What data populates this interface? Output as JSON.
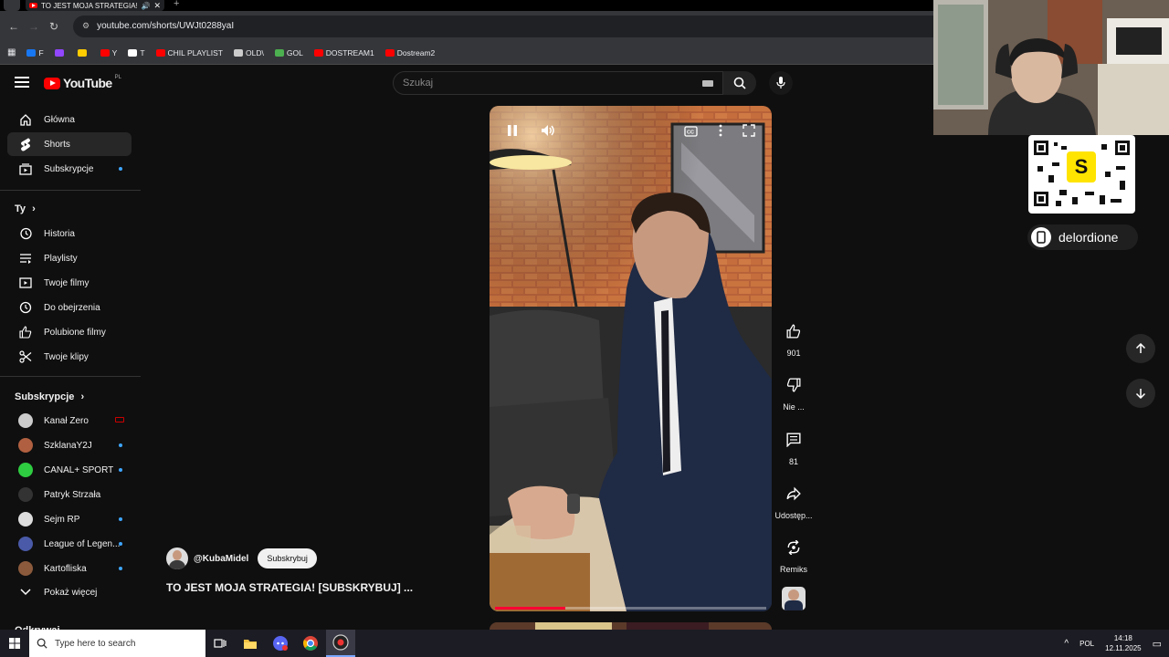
{
  "browser": {
    "tab_title": "TO JEST MOJA STRATEGIA!",
    "url": "youtube.com/shorts/UWJt0288yaI",
    "bookmarks": [
      {
        "label": "F",
        "color": "#1877f2"
      },
      {
        "label": "",
        "color": "#9146ff"
      },
      {
        "label": "",
        "color": "#ffcc00"
      },
      {
        "label": "Y",
        "color": "#ff0000"
      },
      {
        "label": "T",
        "color": "#ffffff"
      },
      {
        "label": "CHIL PLAYLIST",
        "color": "#ff0000"
      },
      {
        "label": "OLD\\",
        "color": "#cccccc"
      },
      {
        "label": "GOL",
        "color": "#4caf50"
      },
      {
        "label": "DOSTREAM1",
        "color": "#ff0000"
      },
      {
        "label": "Dostream2",
        "color": "#ff0000"
      }
    ]
  },
  "header": {
    "logo_text": "YouTube",
    "region": "PL",
    "search_placeholder": "Szukaj"
  },
  "sidebar": {
    "main": [
      {
        "label": "Główna",
        "icon": "home-icon"
      },
      {
        "label": "Shorts",
        "icon": "shorts-icon",
        "active": true
      },
      {
        "label": "Subskrypcje",
        "icon": "subscriptions-icon",
        "dot": true
      }
    ],
    "you_heading": "Ty",
    "you": [
      {
        "label": "Historia",
        "icon": "history-icon"
      },
      {
        "label": "Playlisty",
        "icon": "playlists-icon"
      },
      {
        "label": "Twoje filmy",
        "icon": "your-videos-icon"
      },
      {
        "label": "Do obejrzenia",
        "icon": "watch-later-icon"
      },
      {
        "label": "Polubione filmy",
        "icon": "liked-icon"
      },
      {
        "label": "Twoje klipy",
        "icon": "clips-icon"
      }
    ],
    "subs_heading": "Subskrypcje",
    "subs": [
      {
        "label": "Kanał Zero",
        "color": "#cccccc",
        "badge": "live"
      },
      {
        "label": "SzklanaY2J",
        "color": "#b06040",
        "badge": "dot"
      },
      {
        "label": "CANAL+ SPORT",
        "color": "#2ecc40",
        "badge": "dot"
      },
      {
        "label": "Patryk Strzała",
        "color": "#333333",
        "badge": ""
      },
      {
        "label": "Sejm RP",
        "color": "#dddddd",
        "badge": "dot"
      },
      {
        "label": "League of Legen...",
        "color": "#4a5aa8",
        "badge": "dot"
      },
      {
        "label": "Kartofliska",
        "color": "#8b5a3c",
        "badge": "dot"
      }
    ],
    "show_more": "Pokaż więcej",
    "cut_heading": "Odkrywaj"
  },
  "short": {
    "channel": "@KubaMidel",
    "subscribe_label": "Subskrybuj",
    "title": "TO JEST MOJA STRATEGIA! [SUBSKRYBUJ] ...",
    "progress": 0.26,
    "actions": {
      "likes": "901",
      "dislike": "Nie ...",
      "comments": "81",
      "share": "Udostęp...",
      "remix": "Remiks"
    }
  },
  "overlay": {
    "streamer": "delordione"
  },
  "taskbar": {
    "search_placeholder": "Type here to search",
    "language": "POL",
    "time": "14:18",
    "date": "12.11.2025"
  }
}
